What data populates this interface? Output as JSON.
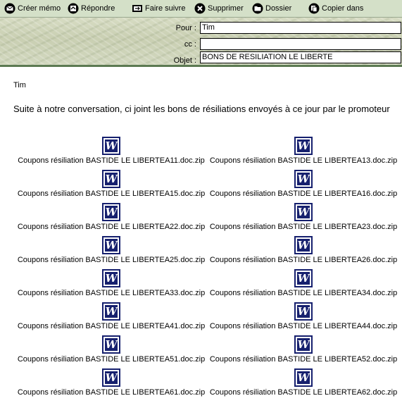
{
  "toolbar": {
    "items": [
      {
        "label": "Créer mémo",
        "icon": "envelope-icon"
      },
      {
        "label": "Répondre",
        "icon": "reply-icon"
      },
      {
        "label": "Faire suivre",
        "icon": "forward-icon"
      },
      {
        "label": "Supprimer",
        "icon": "delete-x-icon"
      },
      {
        "label": "Dossier",
        "icon": "folder-icon"
      },
      {
        "label": "Copier dans",
        "icon": "copy-icon"
      }
    ]
  },
  "header": {
    "to_label": "Pour :",
    "to_value": "Tim",
    "cc_label": "cc :",
    "cc_value": "",
    "subject_label": "Objet :",
    "subject_value": "BONS DE RESILIATION LE LIBERTE"
  },
  "message": {
    "greeting": "Tim",
    "text": "Suite à notre conversation, ci joint les bons de résiliations envoyés à ce jour par le promoteur"
  },
  "attachments": [
    "Coupons résiliation BASTIDE LE LIBERTEA11.doc.zip",
    "Coupons résiliation BASTIDE LE LIBERTEA13.doc.zip",
    "Coupons résiliation BASTIDE LE LIBERTEA15.doc.zip",
    "Coupons résiliation BASTIDE LE LIBERTEA16.doc.zip",
    "Coupons résiliation BASTIDE LE LIBERTEA22.doc.zip",
    "Coupons résiliation BASTIDE LE LIBERTEA23.doc.zip",
    "Coupons résiliation BASTIDE LE LIBERTEA25.doc.zip",
    "Coupons résiliation BASTIDE LE LIBERTEA26.doc.zip",
    "Coupons résiliation BASTIDE LE LIBERTEA33.doc.zip",
    "Coupons résiliation BASTIDE LE LIBERTEA34.doc.zip",
    "Coupons résiliation BASTIDE LE LIBERTEA41.doc.zip",
    "Coupons résiliation BASTIDE LE LIBERTEA44.doc.zip",
    "Coupons résiliation BASTIDE LE LIBERTEA51.doc.zip",
    "Coupons résiliation BASTIDE LE LIBERTEA52.doc.zip",
    "Coupons résiliation BASTIDE LE LIBERTEA61.doc.zip",
    "Coupons résiliation BASTIDE LE LIBERTEA62.doc.zip"
  ],
  "attachment_icon": {
    "name": "word-document-icon",
    "glyph": "W",
    "color": "#16206e"
  }
}
